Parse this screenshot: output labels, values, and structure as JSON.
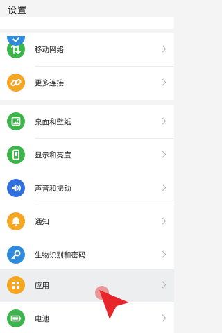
{
  "header": {
    "title": "设置"
  },
  "settings": [
    {
      "label": "移动网络",
      "icon": "mobile-data-icon",
      "color": "#3bb54a"
    },
    {
      "label": "更多连接",
      "icon": "link-icon",
      "color": "#f5a623"
    },
    {
      "label": "桌面和壁纸",
      "icon": "wallpaper-icon",
      "color": "#3bb54a"
    },
    {
      "label": "显示和亮度",
      "icon": "display-icon",
      "color": "#3bb54a"
    },
    {
      "label": "声音和振动",
      "icon": "sound-icon",
      "color": "#2f6fe0"
    },
    {
      "label": "通知",
      "icon": "bell-icon",
      "color": "#f5a623"
    },
    {
      "label": "生物识别和密码",
      "icon": "key-icon",
      "color": "#2f8bdc"
    },
    {
      "label": "应用",
      "icon": "apps-icon",
      "color": "#f5a623"
    },
    {
      "label": "电池",
      "icon": "battery-icon",
      "color": "#3bb54a"
    }
  ],
  "colors": {
    "background": "#f4f4f4",
    "active_row": "#eceeef",
    "pointer": "#e8252b"
  }
}
